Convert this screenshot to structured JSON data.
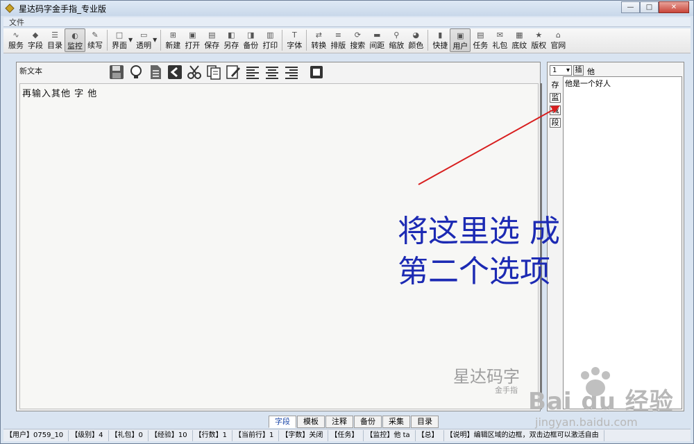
{
  "window": {
    "title": "星达码字金手指_专业版",
    "min": "—",
    "max": "□",
    "close": "✕"
  },
  "menu": {
    "items": [
      "文件"
    ]
  },
  "toolbar": {
    "buttons": [
      {
        "label": "服务",
        "icon": "rss-icon"
      },
      {
        "label": "字段",
        "icon": "diamond-icon"
      },
      {
        "label": "目录",
        "icon": "list-icon"
      },
      {
        "label": "监控",
        "icon": "shield-icon",
        "active": true
      },
      {
        "label": "续写",
        "icon": "pen-icon"
      },
      {
        "label": "界面",
        "icon": "window-icon",
        "dropdown": true
      },
      {
        "label": "透明",
        "icon": "transparent-icon",
        "dropdown": true
      },
      {
        "label": "新建",
        "icon": "new-icon"
      },
      {
        "label": "打开",
        "icon": "open-icon"
      },
      {
        "label": "保存",
        "icon": "save-icon"
      },
      {
        "label": "另存",
        "icon": "save-as-icon"
      },
      {
        "label": "备份",
        "icon": "backup-icon"
      },
      {
        "label": "打印",
        "icon": "print-icon"
      },
      {
        "label": "字体",
        "icon": "font-icon"
      },
      {
        "label": "转换",
        "icon": "convert-icon"
      },
      {
        "label": "排版",
        "icon": "layout-icon"
      },
      {
        "label": "搜索",
        "icon": "search-icon"
      },
      {
        "label": "间距",
        "icon": "spacing-icon"
      },
      {
        "label": "缩放",
        "icon": "zoom-icon"
      },
      {
        "label": "颜色",
        "icon": "color-icon"
      },
      {
        "label": "快捷",
        "icon": "shortcut-icon"
      },
      {
        "label": "用户",
        "icon": "user-icon",
        "active": true
      },
      {
        "label": "任务",
        "icon": "task-icon"
      },
      {
        "label": "礼包",
        "icon": "gift-icon"
      },
      {
        "label": "底纹",
        "icon": "texture-icon"
      },
      {
        "label": "版权",
        "icon": "star-icon"
      },
      {
        "label": "官网",
        "icon": "home-icon"
      }
    ]
  },
  "editor": {
    "doc_title": "新文本",
    "content": "再输入其他 字 他"
  },
  "watermark": {
    "brand": "星达码字",
    "sub": "金手指"
  },
  "right_panel": {
    "select_value": "1",
    "insert_label": "插",
    "word": "他",
    "side_labels": [
      "存",
      "监",
      "减",
      "段"
    ],
    "list_items": [
      "他是一个好人"
    ]
  },
  "annotation": {
    "line1": "将这里选  成",
    "line2": "第二个选项",
    "color": "#1c2ab3"
  },
  "bottom_tabs": [
    "字段",
    "模板",
    "注释",
    "备份",
    "采集",
    "目录"
  ],
  "statusbar": [
    "【用户】0759_10",
    "【级别】4",
    "【礼包】0",
    "【经验】10",
    "【行数】1",
    "【当前行】1",
    "【字数】关闭",
    "【任务】",
    "【监控】他 ta",
    "【总】",
    "【说明】编辑区域的边框，双击边框可以激活自由"
  ],
  "baidu": {
    "main": "Bai du 经验",
    "url": "jingyan.baidu.com"
  }
}
